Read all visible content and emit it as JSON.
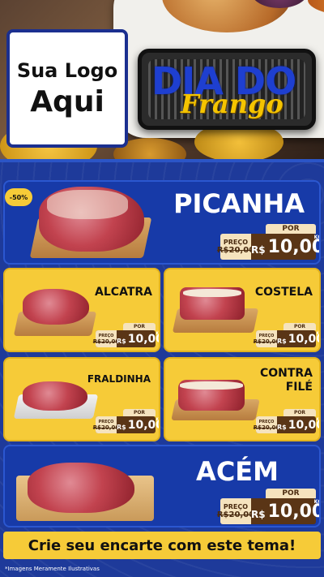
{
  "header": {
    "logo_line1": "Sua Logo",
    "logo_line2": "Aqui",
    "badge_top": "DIA DO",
    "badge_sub": "Frango"
  },
  "discount_badge": "-50%",
  "products": [
    {
      "name": "PICANHA",
      "por": "POR",
      "preco_label": "PREÇO",
      "old": "R$20,00",
      "currency": "R$",
      "price": "10,00",
      "unit": "KG"
    },
    {
      "name": "ALCATRA",
      "por": "POR",
      "preco_label": "PREÇO",
      "old": "R$20,00",
      "currency": "R$",
      "price": "10,00",
      "unit": "KG"
    },
    {
      "name": "COSTELA",
      "por": "POR",
      "preco_label": "PREÇO",
      "old": "R$20,00",
      "currency": "R$",
      "price": "10,00",
      "unit": "KG"
    },
    {
      "name": "FRALDINHA",
      "por": "POR",
      "preco_label": "PREÇO",
      "old": "R$20,00",
      "currency": "R$",
      "price": "10,00",
      "unit": "KG"
    },
    {
      "name_line1": "CONTRA",
      "name_line2": "FILÉ",
      "por": "POR",
      "preco_label": "PREÇO",
      "old": "R$20,00",
      "currency": "R$",
      "price": "10,00",
      "unit": "KG"
    },
    {
      "name": "ACÉM",
      "por": "POR",
      "preco_label": "PREÇO",
      "old": "R$20,00",
      "currency": "R$",
      "price": "10,00",
      "unit": "KG"
    }
  ],
  "cta": "Crie seu encarte com este tema!",
  "footnote": "*Imagens Meramente Ilustrativas",
  "colors": {
    "blue": "#1e3a9a",
    "yellow": "#f6cb38",
    "brown": "#5a3516"
  }
}
